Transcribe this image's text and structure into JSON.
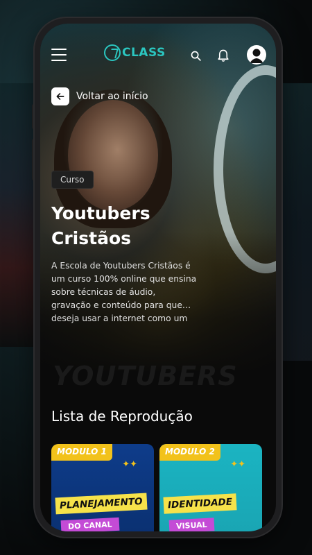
{
  "header": {
    "logo_text": "CLASS",
    "logo_mark": "7",
    "menu_icon": "hamburger-icon",
    "search_icon": "search-icon",
    "bell_icon": "bell-icon",
    "avatar_icon": "user-avatar-icon"
  },
  "back": {
    "label": "Voltar ao início",
    "icon": "arrow-left-icon"
  },
  "course": {
    "badge": "Curso",
    "title": "Youtubers Cristãos",
    "description": "A Escola de Youtubers Cristãos é um curso 100% online que ensina sobre técnicas de áudio, gravação e conteúdo para que… deseja usar a internet como um",
    "watermark": "YOUTUBERS"
  },
  "playlist": {
    "title": "Lista de Reprodução",
    "modules": [
      {
        "tag": "MODULO 1",
        "title": "PLANEJAMENTO",
        "subtitle": "DO CANAL",
        "color": "#0e3c8a"
      },
      {
        "tag": "MODULO 2",
        "title": "IDENTIDADE",
        "subtitle": "VISUAL",
        "color": "#1bb4c2"
      }
    ]
  },
  "colors": {
    "accent": "#2bc6c0",
    "highlight": "#f2c21b",
    "badge_bg": "#1f1f1f"
  }
}
